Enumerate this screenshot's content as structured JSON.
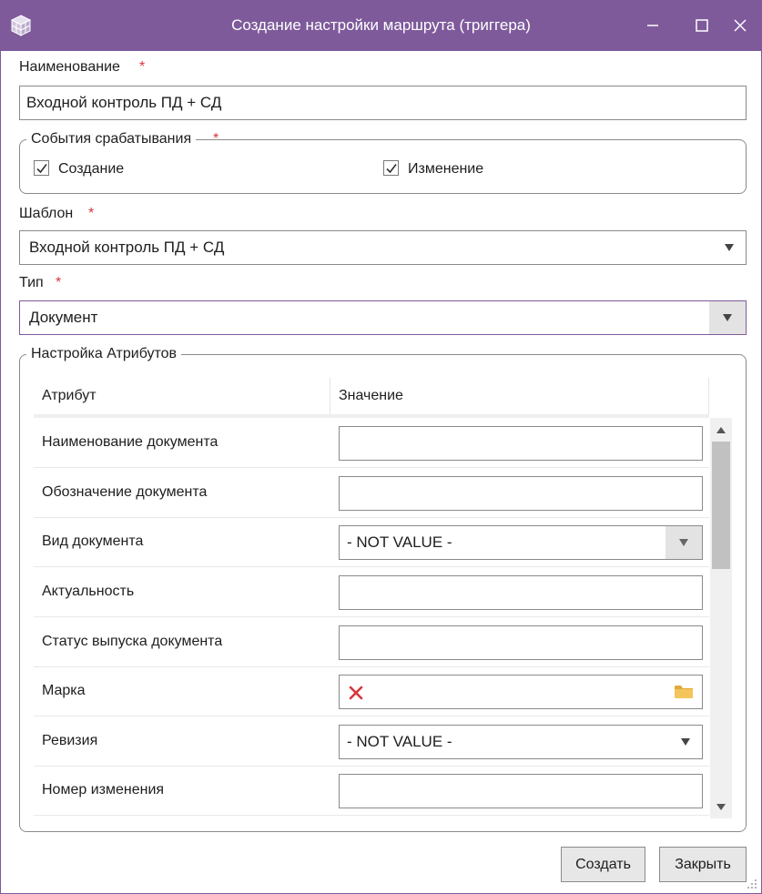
{
  "window": {
    "title": "Создание настройки маршрута (триггера)",
    "accent_color": "#7e5a9b",
    "controls": [
      "minimize-icon",
      "maximize-icon",
      "close-icon"
    ]
  },
  "form": {
    "name_label": "Наименование",
    "name_value": "Входной контроль ПД + СД",
    "required_mark": "*",
    "events": {
      "title": "События срабатывания",
      "create_label": "Создание",
      "create_checked": true,
      "change_label": "Изменение",
      "change_checked": true
    },
    "template_label": "Шаблон",
    "template_value": "Входной контроль ПД + СД",
    "type_label": "Тип",
    "type_value": "Документ"
  },
  "attributes": {
    "title": "Настройка Атрибутов",
    "columns": [
      "Атрибут",
      "Значение"
    ],
    "rows": [
      {
        "label": "Наименование документа",
        "kind": "text",
        "value": ""
      },
      {
        "label": "Обозначение документа",
        "kind": "text",
        "value": ""
      },
      {
        "label": "Вид документа",
        "kind": "combo-box",
        "value": "- NOT VALUE -"
      },
      {
        "label": "Актуальность",
        "kind": "text",
        "value": ""
      },
      {
        "label": "Статус выпуска документа",
        "kind": "text",
        "value": ""
      },
      {
        "label": "Марка",
        "kind": "picker",
        "value": "",
        "icons": [
          "clear-x-icon",
          "folder-icon"
        ]
      },
      {
        "label": "Ревизия",
        "kind": "combo",
        "value": "- NOT VALUE -"
      },
      {
        "label": "Номер изменения",
        "kind": "text",
        "value": ""
      }
    ]
  },
  "buttons": {
    "create": "Создать",
    "close": "Закрыть"
  },
  "colors": {
    "required": "#d9363e",
    "folder": "#e8b84a",
    "clear": "#d9363e"
  }
}
